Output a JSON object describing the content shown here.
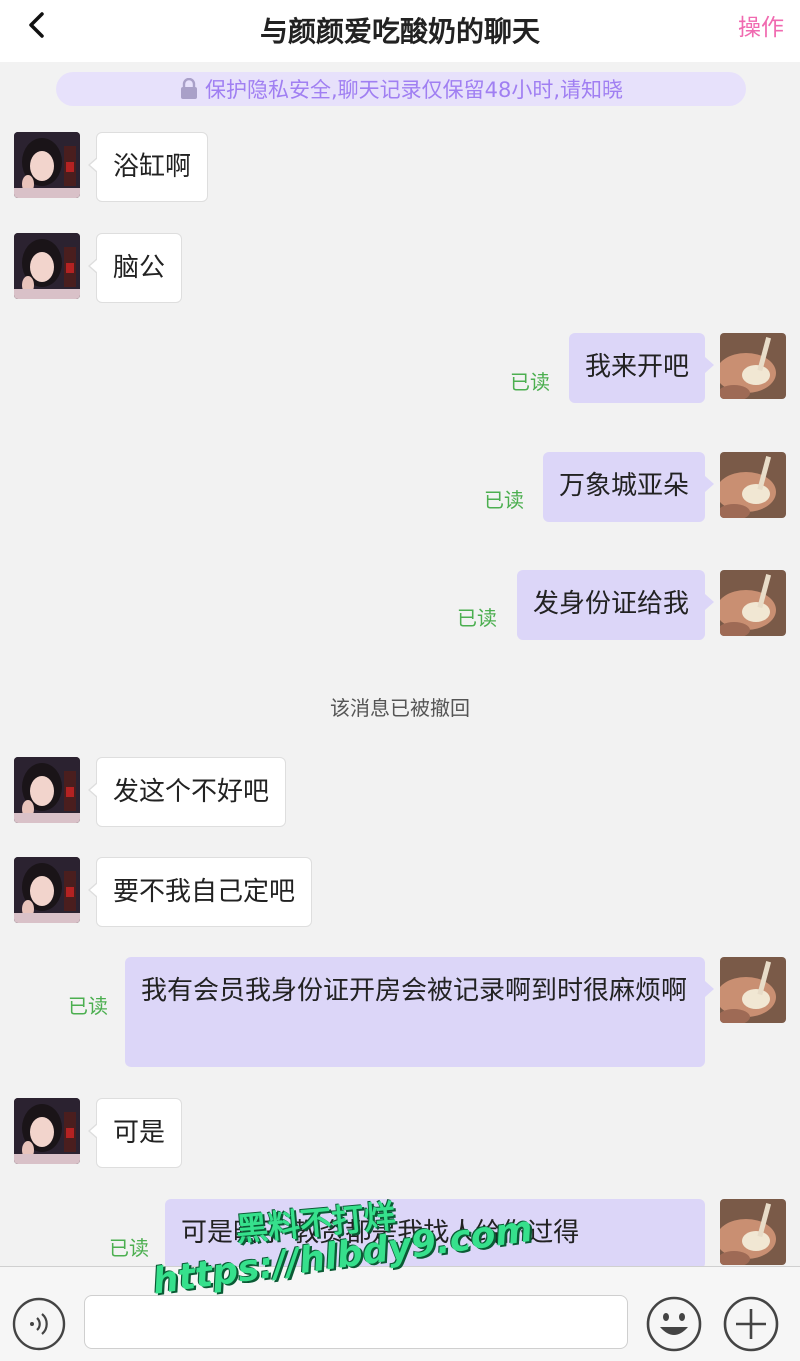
{
  "header": {
    "title": "与颜颜爱吃酸奶的聊天",
    "action_label": "操作"
  },
  "notice": {
    "text": "保护隐私安全,聊天记录仅保留48小时,请知晓"
  },
  "messages": [
    {
      "side": "left",
      "text": "浴缸啊"
    },
    {
      "side": "left",
      "text": "脑公"
    },
    {
      "side": "right",
      "text": "我来开吧",
      "status": "已读"
    },
    {
      "side": "right",
      "text": "万象城亚朵",
      "status": "已读"
    },
    {
      "side": "right",
      "text": "发身份证给我",
      "status": "已读"
    },
    {
      "side": "system",
      "text": "该消息已被撤回"
    },
    {
      "side": "left",
      "text": "发这个不好吧"
    },
    {
      "side": "left",
      "text": "要不我自己定吧"
    },
    {
      "side": "right",
      "text": "我有会员我身份证开房会被记录啊到时很麻烦啊",
      "status": "已读"
    },
    {
      "side": "left",
      "text": "可是"
    },
    {
      "side": "right",
      "text": "可是晗子 教资都是我找人给你过得",
      "status": "已读"
    }
  ],
  "watermark": {
    "line1": "黑料不打烊",
    "line2": "https://hlbdy9.com"
  },
  "composer": {
    "placeholder": ""
  },
  "icons": {
    "back": "chevron-left-icon",
    "lock": "lock-icon",
    "voice": "voice-icon",
    "emoji": "smiley-icon",
    "plus": "plus-icon"
  },
  "colors": {
    "accent": "#f06ab0",
    "notice_text": "#a07ff2",
    "sent_bubble": "#dcd6f8",
    "read_status": "#4caf50"
  }
}
